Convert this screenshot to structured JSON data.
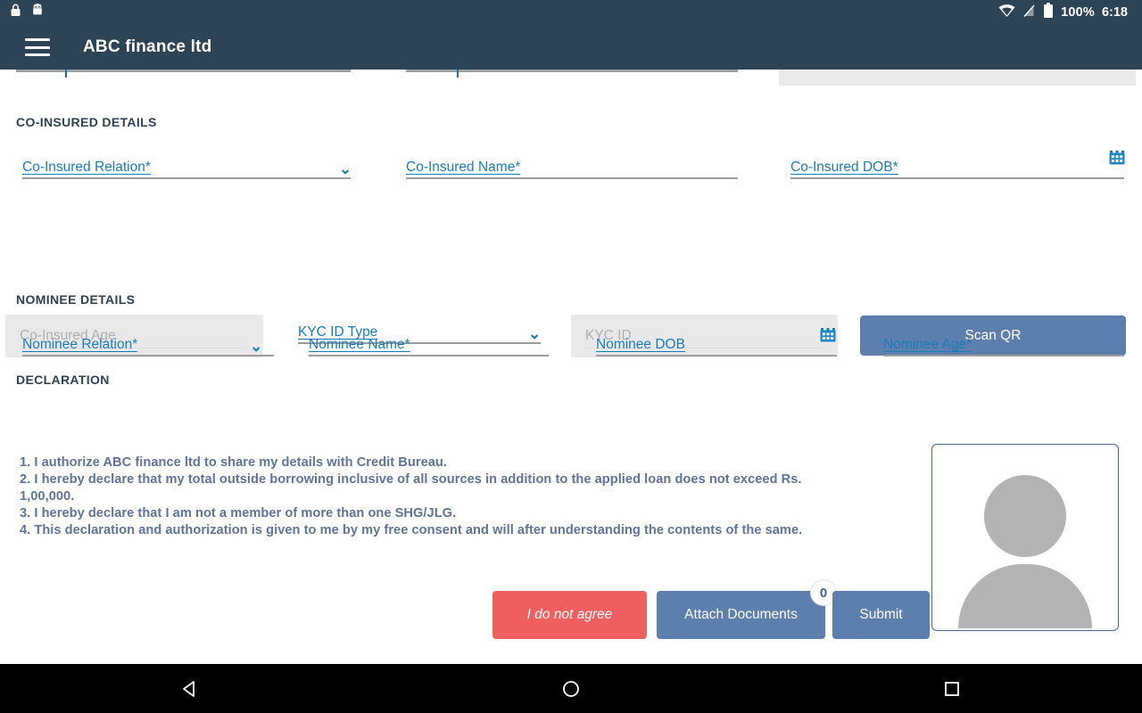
{
  "statusbar": {
    "icons": [
      "lock-icon",
      "android-robot-icon",
      "wifi-icon",
      "signal-off-icon",
      "battery-icon"
    ],
    "battery_text": "100%",
    "time": "6:18"
  },
  "appbar": {
    "menu_icon": "hamburger-menu-icon",
    "title": "ABC finance ltd"
  },
  "sections": {
    "coinsured": {
      "title": "CO-INSURED DETAILS",
      "fields": {
        "relation": {
          "label": "Co-Insured Relation*",
          "type": "dropdown"
        },
        "name": {
          "label": "Co-Insured Name*",
          "type": "text"
        },
        "dob": {
          "label": "Co-Insured DOB*",
          "type": "date",
          "icon": "calendar-icon"
        },
        "age": {
          "label": "Co-Insured Age",
          "type": "text-disabled"
        },
        "kyc_type": {
          "label": "KYC ID Type",
          "type": "dropdown"
        },
        "kyc_id": {
          "label": "KYC ID",
          "type": "text-disabled"
        }
      },
      "scan_button": "Scan QR"
    },
    "nominee": {
      "title": "NOMINEE DETAILS",
      "fields": {
        "relation": {
          "label": "Nominee Relation*",
          "type": "dropdown"
        },
        "name": {
          "label": "Nominee Name*",
          "type": "text"
        },
        "dob": {
          "label": "Nominee DOB",
          "type": "date",
          "icon": "calendar-icon"
        },
        "age": {
          "label": "Nominee Age*",
          "type": "text"
        }
      }
    },
    "declaration": {
      "title": "DECLARATION",
      "items": [
        "1. I authorize ABC finance ltd to share my details with Credit Bureau.",
        "2. I hereby declare that my total outside borrowing inclusive of all sources in addition to the applied loan does not exceed Rs. 1,00,000.",
        "3. I hereby declare that I am not a member of more than one SHG/JLG.",
        "4. This declaration and authorization is given to me by my free consent and will after understanding the contents of the same."
      ]
    }
  },
  "photo": {
    "placeholder_icon": "person-avatar-icon"
  },
  "actions": {
    "disagree": "I do not agree",
    "attach": "Attach Documents",
    "attach_count": "0",
    "submit": "Submit"
  },
  "navbar": {
    "back": "back-triangle-icon",
    "home": "home-circle-icon",
    "recents": "recents-square-icon"
  },
  "colors": {
    "header": "#2d4356",
    "label_blue": "#1a7bb9",
    "button_blue": "#5c7fad",
    "button_red": "#ef5f5f",
    "declaration_text": "#5f739b"
  }
}
